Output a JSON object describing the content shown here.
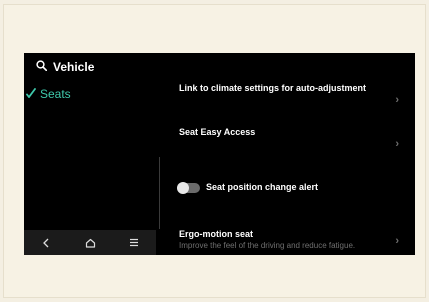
{
  "header": {
    "title": "Vehicle",
    "icon": "search-icon"
  },
  "sidebar": {
    "items": [
      {
        "label": "Seats",
        "icon": "checkmark-icon",
        "selected": true
      }
    ]
  },
  "settings": {
    "link_climate": {
      "label": "Link to climate settings for auto-adjustment"
    },
    "seat_easy_access": {
      "label": "Seat Easy Access"
    },
    "seat_position_alert": {
      "label": "Seat position change alert",
      "enabled": false
    },
    "ergo_motion": {
      "label": "Ergo-motion seat",
      "description": "Improve the feel of the driving and reduce fatigue."
    }
  },
  "bottom_nav": {
    "icons": [
      "back-icon",
      "home-icon",
      "menu-icon"
    ]
  },
  "colors": {
    "accent": "#3fc9ab",
    "background": "#000000",
    "frame": "#f7f2e4"
  }
}
